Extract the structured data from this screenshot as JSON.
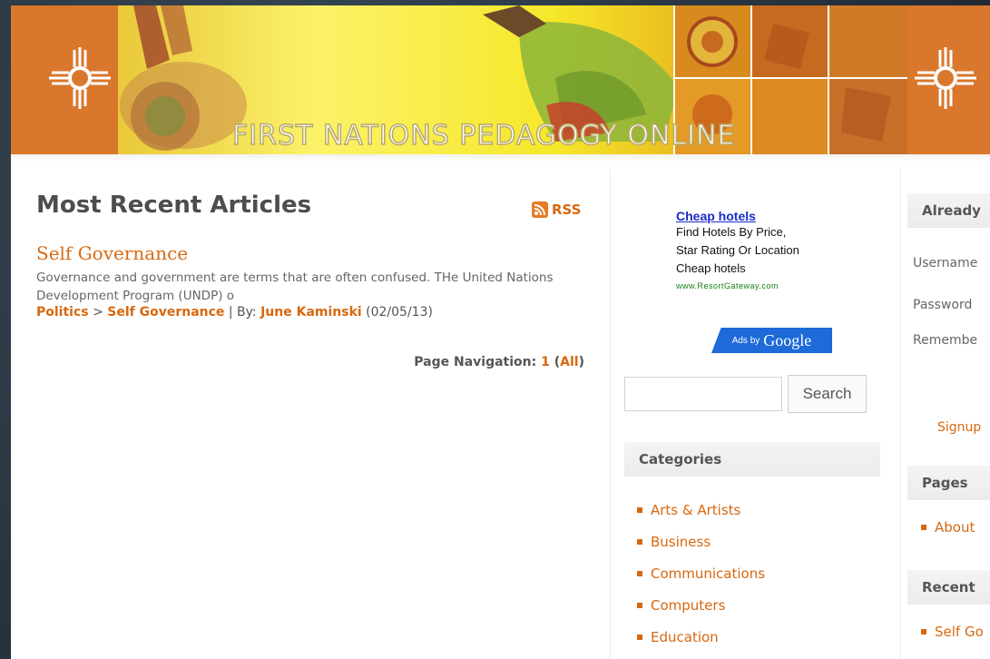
{
  "header": {
    "banner_title": "FIRST NATIONS PEDAGOGY ONLINE"
  },
  "main": {
    "heading": "Most Recent Articles",
    "rss_label": "RSS",
    "article": {
      "title": "Self Governance",
      "excerpt": "Governance and government are terms that are often confused. THe United Nations Development Program (UNDP) o",
      "category": "Politics",
      "separator": ">",
      "subcategory": "Self Governance",
      "by_label": "| By:",
      "author": "June Kaminski",
      "date": "(02/05/13)"
    },
    "page_nav": {
      "label": "Page Navigation:",
      "current": "1",
      "all": "All"
    }
  },
  "ad": {
    "title": "Cheap hotels",
    "line1": "Find Hotels By Price,",
    "line2": "Star Rating Or Location",
    "line3": "Cheap hotels",
    "url": "www.ResortGateway.com",
    "ads_by": "Ads by",
    "google": "Google"
  },
  "search": {
    "button_label": "Search",
    "placeholder": ""
  },
  "categories": {
    "heading": "Categories",
    "items": [
      "Arts & Artists",
      "Business",
      "Communications",
      "Computers",
      "Education"
    ]
  },
  "right": {
    "login_heading": "Already",
    "username_label": "Username",
    "password_label": "Password",
    "remember_label": "Remembe",
    "signup": "Signup",
    "pages_heading": "Pages",
    "pages_item": "About",
    "recent_heading": "Recent",
    "recent_item": "Self Go"
  },
  "colors": {
    "accent": "#d8680f",
    "header_orange": "#d9772c",
    "ad_link": "#1a2bc8",
    "ad_url": "#118011"
  }
}
